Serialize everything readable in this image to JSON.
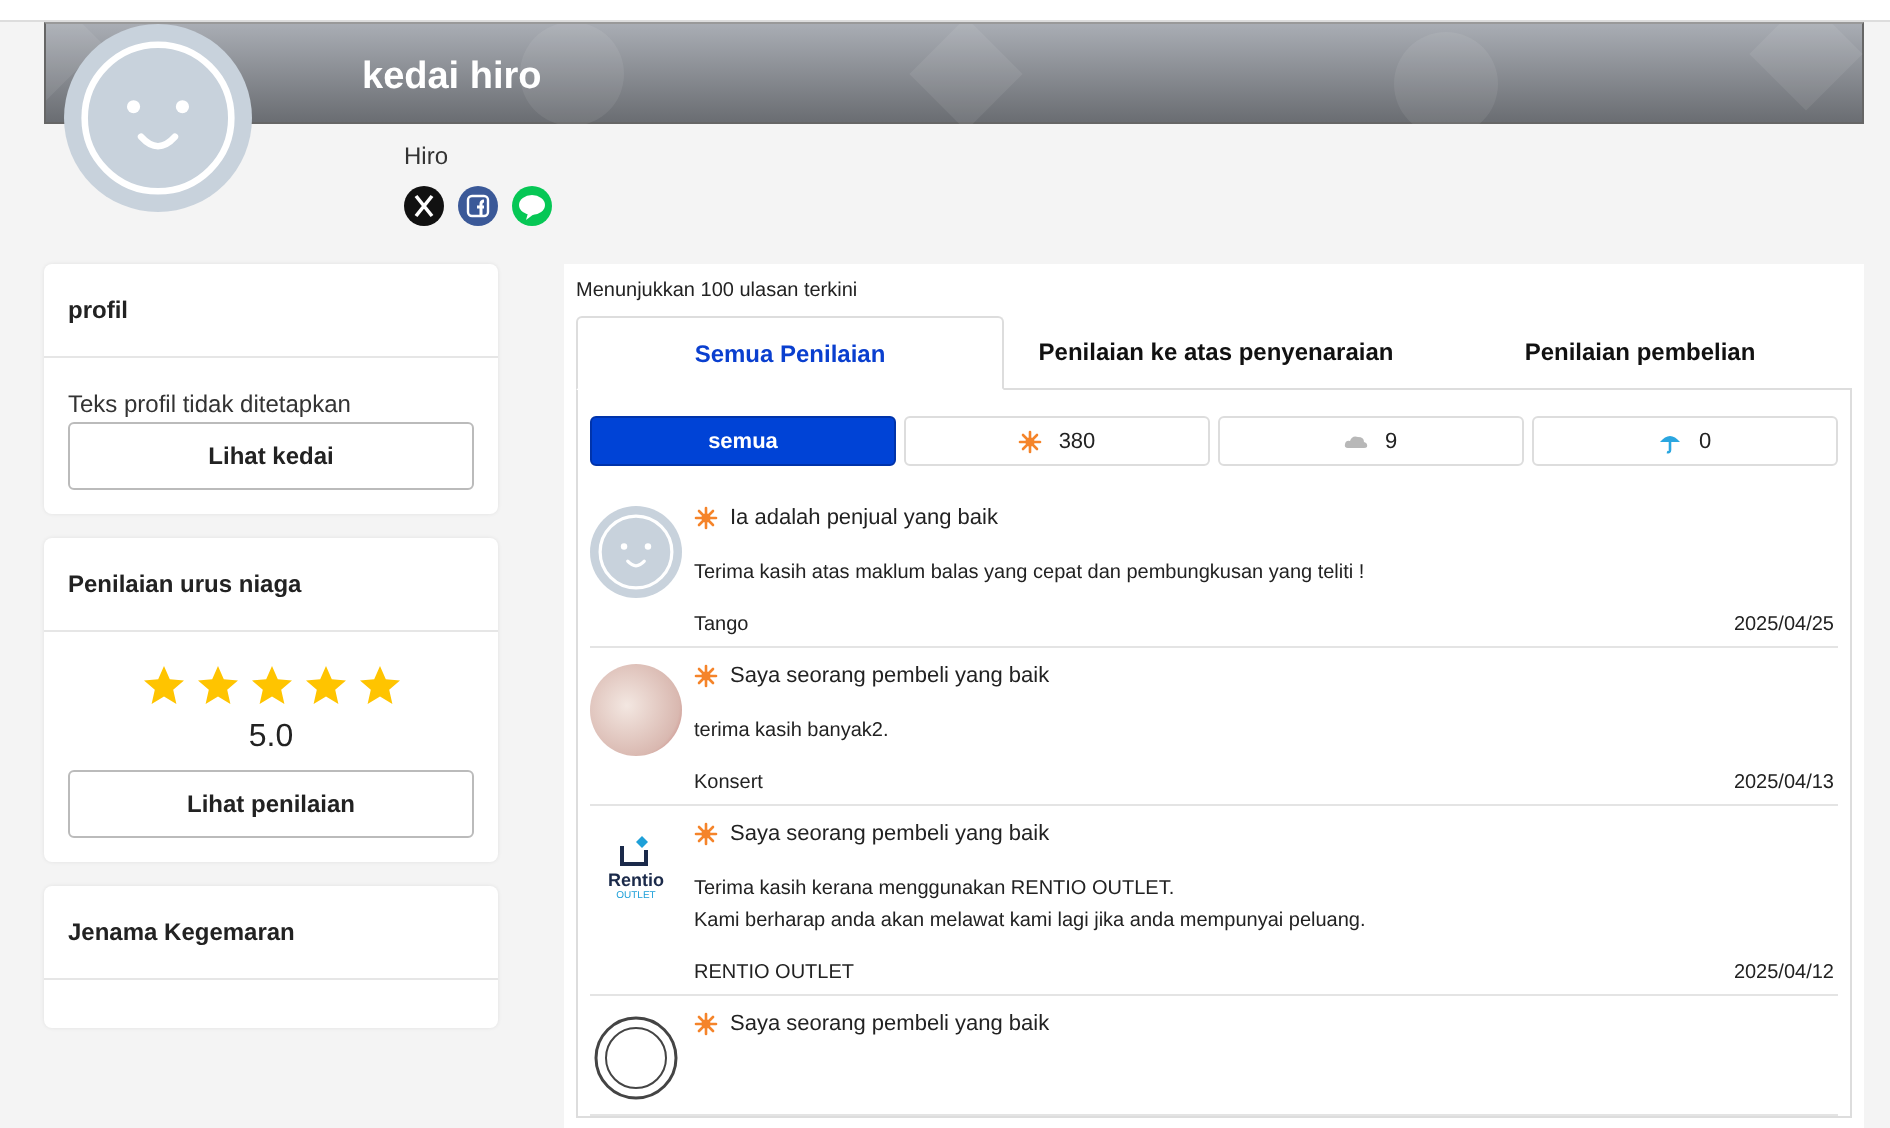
{
  "shop": {
    "name": "kedai hiro",
    "owner": "Hiro",
    "social": [
      {
        "kind": "x"
      },
      {
        "kind": "facebook"
      },
      {
        "kind": "line"
      }
    ]
  },
  "sidebar": [
    {
      "title": "profil",
      "text": "Teks profil tidak ditetapkan",
      "button": "Lihat kedai"
    },
    {
      "title": "Penilaian urus niaga",
      "stars": 5,
      "score": "5.0",
      "button": "Lihat penilaian"
    },
    {
      "title": "Jenama Kegemaran"
    }
  ],
  "reviews_panel": {
    "summary": "Menunjukkan 100 ulasan terkini",
    "tabs": [
      {
        "label": "Semua Penilaian",
        "selected": true
      },
      {
        "label": "Penilaian ke atas penyenaraian",
        "selected": false
      },
      {
        "label": "Penilaian pembelian",
        "selected": false
      }
    ],
    "filters": [
      {
        "kind": "all",
        "label": "semua",
        "selected": true
      },
      {
        "kind": "good",
        "label": "380",
        "selected": false
      },
      {
        "kind": "normal",
        "label": "9",
        "selected": false
      },
      {
        "kind": "bad",
        "label": "0",
        "selected": false
      }
    ],
    "reviews": [
      {
        "kind": "face",
        "title": "Ia adalah penjual yang baik",
        "body": [
          "Terima kasih atas maklum balas yang cepat dan pembungkusan yang teliti !"
        ],
        "author": "Tango",
        "date": "2025/04/25"
      },
      {
        "kind": "photo",
        "title": "Saya seorang pembeli yang baik",
        "body": [
          "terima kasih banyak2."
        ],
        "author": "Konsert",
        "date": "2025/04/13"
      },
      {
        "kind": "logo",
        "title": "Saya seorang pembeli yang baik",
        "body": [
          "Terima kasih kerana menggunakan RENTIO OUTLET.",
          "Kami berharap anda akan melawat kami lagi jika anda mempunyai peluang."
        ],
        "author": "RENTIO OUTLET",
        "date": "2025/04/12",
        "logo_text": [
          "Rentio",
          "OUTLET"
        ]
      },
      {
        "kind": "ring",
        "title": "Saya seorang pembeli yang baik"
      }
    ]
  }
}
